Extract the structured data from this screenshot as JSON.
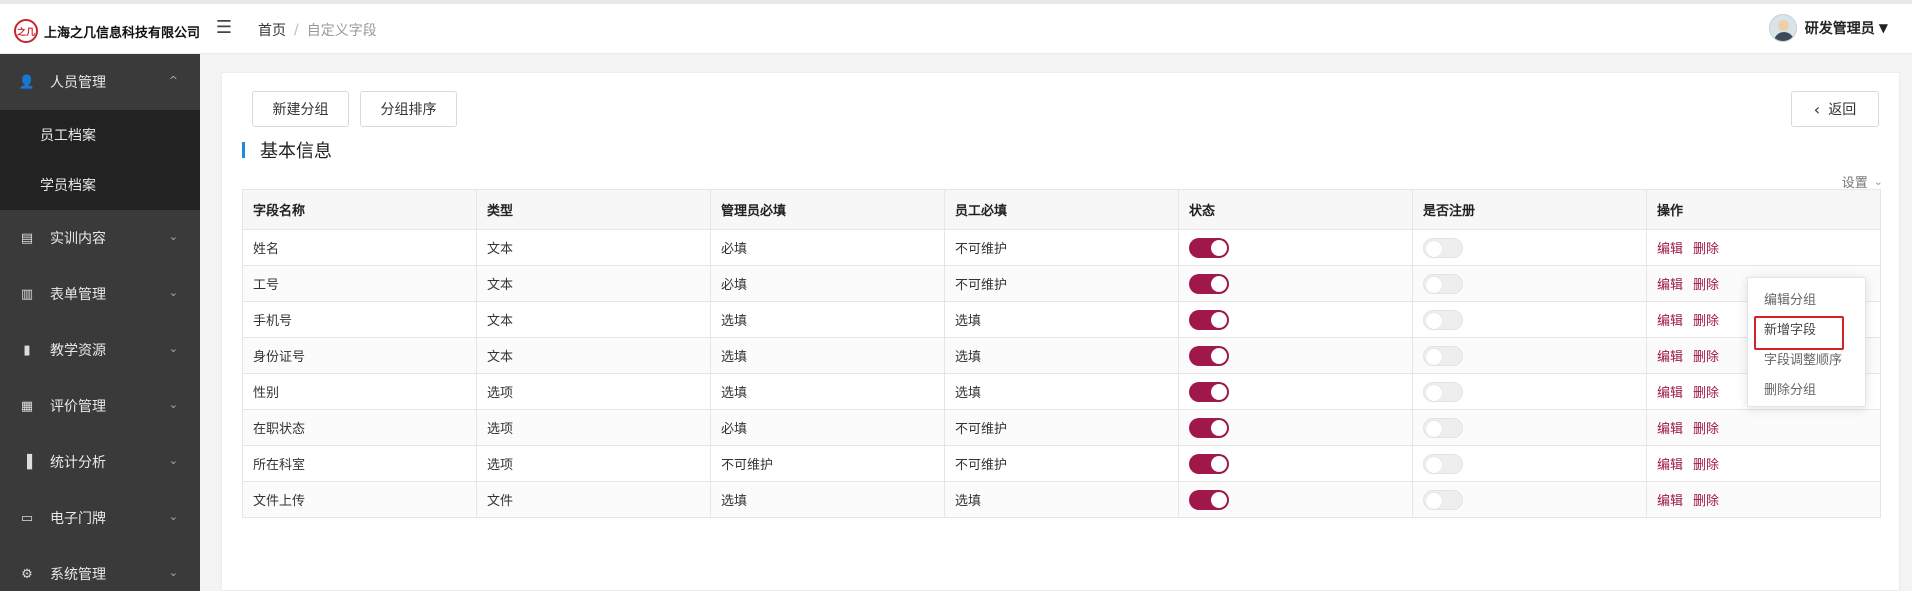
{
  "header": {
    "logo_mark": "之几",
    "company_name": "上海之几信息科技有限公司",
    "breadcrumb": {
      "home": "首页",
      "separator": "/",
      "current": "自定义字段"
    },
    "user": {
      "name": "研发管理员",
      "caret": "▼"
    }
  },
  "sidebar": {
    "items": [
      {
        "label": "人员管理",
        "icon": "people-icon",
        "glyph": "👤",
        "chevron": "^"
      },
      {
        "label": "实训内容",
        "icon": "book-icon",
        "glyph": "▤",
        "chevron": "⌄"
      },
      {
        "label": "表单管理",
        "icon": "form-icon",
        "glyph": "▥",
        "chevron": "⌄"
      },
      {
        "label": "教学资源",
        "icon": "resource-icon",
        "glyph": "▮",
        "chevron": "⌄"
      },
      {
        "label": "评价管理",
        "icon": "evaluate-icon",
        "glyph": "▦",
        "chevron": "⌄"
      },
      {
        "label": "统计分析",
        "icon": "chart-icon",
        "glyph": "▐",
        "chevron": "⌄"
      },
      {
        "label": "电子门牌",
        "icon": "monitor-icon",
        "glyph": "▭",
        "chevron": "⌄"
      },
      {
        "label": "系统管理",
        "icon": "gear-icon",
        "glyph": "⚙",
        "chevron": "⌄"
      }
    ],
    "submenu": [
      {
        "label": "员工档案"
      },
      {
        "label": "学员档案"
      }
    ]
  },
  "toolbar": {
    "new_group_label": "新建分组",
    "sort_group_label": "分组排序",
    "back_label": "返回",
    "back_icon": "‹"
  },
  "section": {
    "title": "基本信息",
    "settings_label": "设置",
    "settings_chevron": "⌄"
  },
  "table": {
    "headers": [
      "字段名称",
      "类型",
      "管理员必填",
      "员工必填",
      "状态",
      "是否注册",
      "操作"
    ],
    "rows": [
      {
        "name": "姓名",
        "type": "文本",
        "admin_required": "必填",
        "staff_required": "不可维护",
        "status_on": true,
        "registered": false
      },
      {
        "name": "工号",
        "type": "文本",
        "admin_required": "必填",
        "staff_required": "不可维护",
        "status_on": true,
        "registered": false
      },
      {
        "name": "手机号",
        "type": "文本",
        "admin_required": "选填",
        "staff_required": "选填",
        "status_on": true,
        "registered": false
      },
      {
        "name": "身份证号",
        "type": "文本",
        "admin_required": "选填",
        "staff_required": "选填",
        "status_on": true,
        "registered": false
      },
      {
        "name": "性别",
        "type": "选项",
        "admin_required": "选填",
        "staff_required": "选填",
        "status_on": true,
        "registered": false
      },
      {
        "name": "在职状态",
        "type": "选项",
        "admin_required": "必填",
        "staff_required": "不可维护",
        "status_on": true,
        "registered": false
      },
      {
        "name": "所在科室",
        "type": "选项",
        "admin_required": "不可维护",
        "staff_required": "不可维护",
        "status_on": true,
        "registered": false
      },
      {
        "name": "文件上传",
        "type": "文件",
        "admin_required": "选填",
        "staff_required": "选填",
        "status_on": true,
        "registered": false
      }
    ],
    "actions": {
      "edit": "编辑",
      "delete": "删除"
    }
  },
  "dropdown": {
    "items": [
      {
        "label": "编辑分组"
      },
      {
        "label": "新增字段"
      },
      {
        "label": "字段调整顺序"
      },
      {
        "label": "删除分组"
      }
    ]
  },
  "colors": {
    "accent": "#a0174a",
    "section_bar": "#1a8ce0",
    "highlight_border": "#d32029",
    "sidebar_bg": "#3a3a3a"
  }
}
